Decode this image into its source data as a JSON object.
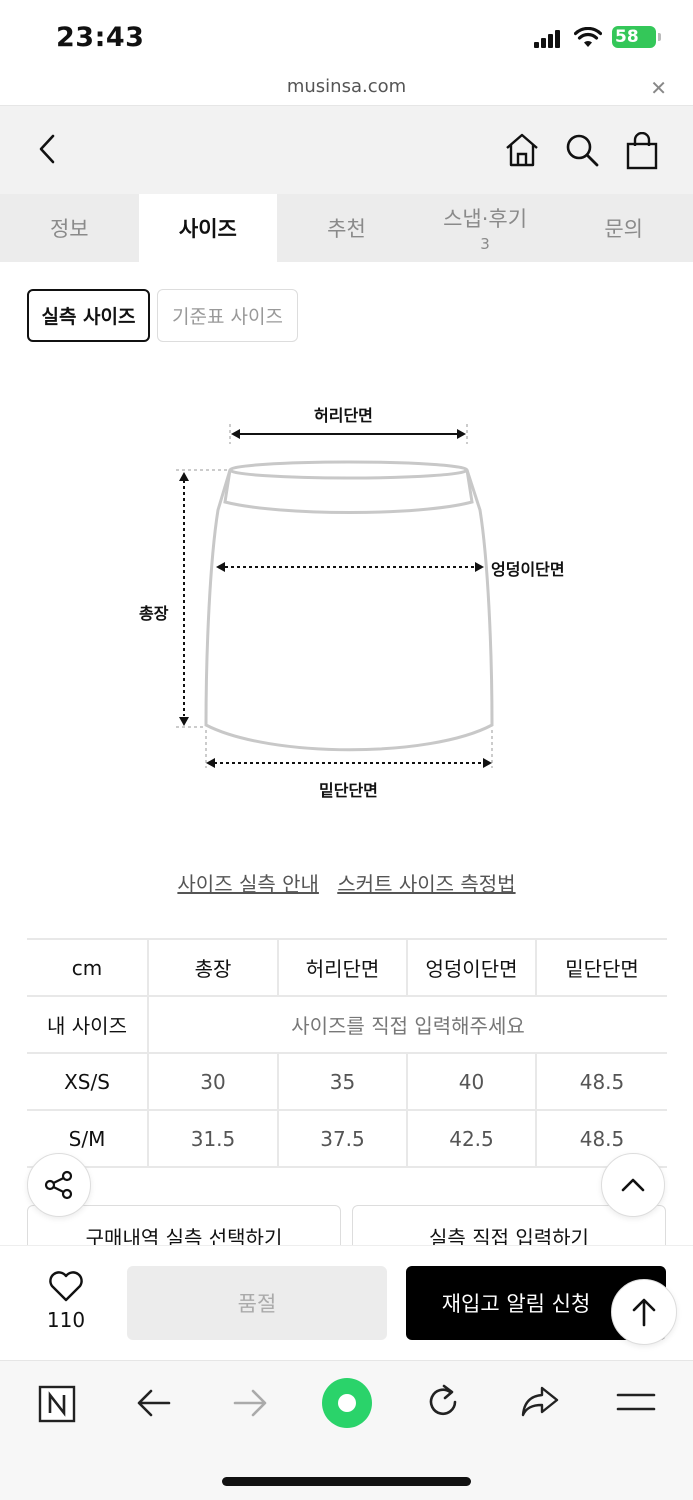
{
  "status_bar": {
    "time": "23:43",
    "battery": "58"
  },
  "url_bar": {
    "domain": "musinsa.com"
  },
  "tabs": [
    {
      "label": "정보"
    },
    {
      "label": "사이즈"
    },
    {
      "label": "추천"
    },
    {
      "label": "스냅·후기",
      "count": "3"
    },
    {
      "label": "문의"
    }
  ],
  "size_toggle": {
    "actual": "실측 사이즈",
    "standard": "기준표 사이즈"
  },
  "diagram": {
    "waist": "허리단면",
    "hip": "엉덩이단면",
    "length": "총장",
    "hem": "밑단단면"
  },
  "guide_links": {
    "measure_guide": "사이즈 실측 안내",
    "skirt_method": "스커트 사이즈 측정법"
  },
  "size_table": {
    "headers": [
      "cm",
      "총장",
      "허리단면",
      "엉덩이단면",
      "밑단단면"
    ],
    "my_size_label": "내 사이즈",
    "my_size_placeholder": "사이즈를 직접 입력해주세요",
    "rows": [
      {
        "size": "XS/S",
        "values": [
          "30",
          "35",
          "40",
          "48.5"
        ]
      },
      {
        "size": "S/M",
        "values": [
          "31.5",
          "37.5",
          "42.5",
          "48.5"
        ]
      }
    ]
  },
  "measure_buttons": {
    "from_purchase": "구매내역 실측 선택하기",
    "direct_input": "실측 직접 입력하기"
  },
  "purchase_bar": {
    "like_count": "110",
    "soldout": "품절",
    "restock": "재입고 알림 신청"
  }
}
